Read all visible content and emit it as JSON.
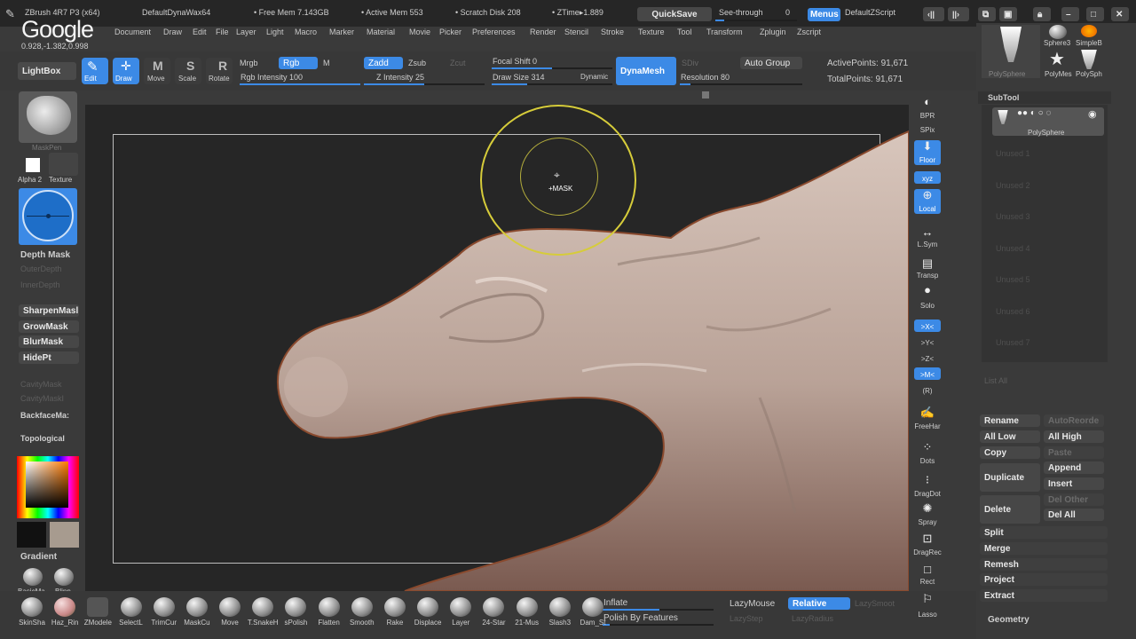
{
  "titlebar": {
    "app": "ZBrush 4R7 P3 (x64)",
    "doc": "DefaultDynaWax64",
    "free_mem": "• Free Mem 7.143GB",
    "active_mem": "• Active Mem 553",
    "scratch": "• Scratch Disk 208",
    "ztime": "• ZTime▸1.889",
    "quicksave": "QuickSave",
    "seethrough": "See-through",
    "seethrough_val": "0",
    "menus": "Menus",
    "script": "DefaultZScript",
    "coords": "0.928,-1.382,0.998"
  },
  "watermark": "Google",
  "menu": [
    "Document",
    "Draw",
    "Edit",
    "File",
    "Layer",
    "Light",
    "Macro",
    "Marker",
    "Material",
    "Movie",
    "Picker",
    "Preferences",
    "Render",
    "Stencil",
    "Stroke",
    "Texture",
    "Tool",
    "Transform",
    "Zplugin",
    "Zscript"
  ],
  "toolbar": {
    "lightbox": "LightBox",
    "edit": "Edit",
    "draw": "Draw",
    "move": "Move",
    "scale": "Scale",
    "rotate": "Rotate",
    "mrgb": "Mrgb",
    "rgb": "Rgb",
    "m": "M",
    "zadd": "Zadd",
    "zsub": "Zsub",
    "zcut": "Zcut",
    "rgb_intensity": "Rgb Intensity 100",
    "z_intensity": "Z Intensity 25",
    "focal_shift": "Focal Shift 0",
    "draw_size": "Draw Size 314",
    "dynamic": "Dynamic",
    "dynamesh": "DynaMesh",
    "sdiv": "SDiv",
    "auto_group": "Auto Group",
    "resolution": "Resolution 80",
    "active_points": "ActivePoints: 91,671",
    "total_points": "TotalPoints: 91,671"
  },
  "left": {
    "brush_label": "MaskPen",
    "alpha": "Alpha 2",
    "texture": "Texture",
    "depth_mask": "Depth Mask",
    "outer_depth": "OuterDepth",
    "inner_depth": "InnerDepth",
    "sharpen": "SharpenMasl",
    "grow": "GrowMask",
    "blur": "BlurMask",
    "hidept": "HidePt",
    "cavity": "CavityMask",
    "cavityf": "CavityMaskI",
    "backface": "BackfaceMa:",
    "topological": "Topological",
    "gradient": "Gradient",
    "basicmat": "BasicMa",
    "blinn": "Blinn"
  },
  "canvas": {
    "cursor_label": "+MASK"
  },
  "right_shelf": [
    "BPR",
    "SPix",
    "Floor",
    "xyz",
    "Local",
    "L.Sym",
    "Transp",
    "Solo",
    ">X<",
    ">Y<",
    ">Z<",
    ">M<",
    "(R)",
    "FreeHar",
    "Dots",
    "DragDot",
    "Spray",
    "DragRec",
    "Rect",
    "Lasso"
  ],
  "tool_panel": {
    "thumbs": [
      "Sphere3",
      "SimpleB",
      "PolySphere",
      "PolyMes",
      "PolySph"
    ],
    "subtool": "SubTool",
    "subtool_item": "PolySphere",
    "unused": [
      "Unused 1",
      "Unused 2",
      "Unused 3",
      "Unused 4",
      "Unused 5",
      "Unused 6",
      "Unused 7"
    ],
    "list_all": "List All",
    "rename": "Rename",
    "autoreorder": "AutoReorde",
    "all_low": "All Low",
    "all_high": "All High",
    "copy": "Copy",
    "paste": "Paste",
    "duplicate": "Duplicate",
    "append": "Append",
    "insert": "Insert",
    "delete": "Delete",
    "del_other": "Del Other",
    "del_all": "Del All",
    "split": "Split",
    "merge": "Merge",
    "remesh": "Remesh",
    "project": "Project",
    "extract": "Extract",
    "geometry": "Geometry"
  },
  "bottom": {
    "brushes": [
      "SkinSha",
      "Haz_Rin",
      "ZModele",
      "SelectL",
      "TrimCur",
      "MaskCu",
      "Move",
      "T.SnakeH",
      "sPolish",
      "Flatten",
      "Smooth",
      "Rake",
      "Displace",
      "Layer",
      "24-Star",
      "21-Mus",
      "Slash3",
      "Dam_St"
    ],
    "inflate": "Inflate",
    "polish": "Polish By Features",
    "lazymouse": "LazyMouse",
    "relative": "Relative",
    "lazysmooth": "LazySmoot",
    "lazystep": "LazyStep",
    "lazyradius": "LazyRadius"
  },
  "colors": {
    "accent": "#3c8ae6",
    "ui_bg": "#3a3a3a",
    "canvas_bg": "#262626",
    "flesh": "#b9a297"
  }
}
